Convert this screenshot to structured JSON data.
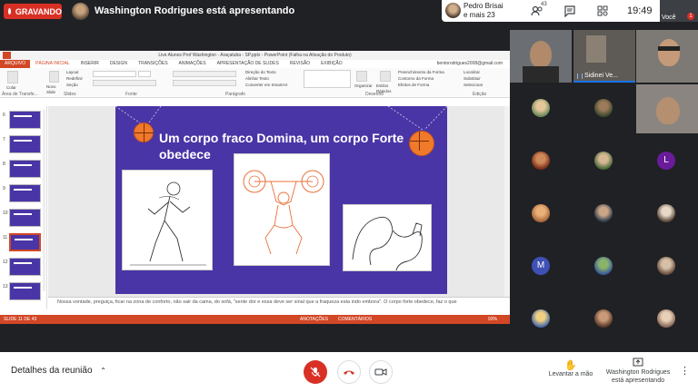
{
  "top": {
    "recording_label": "GRAVANDO",
    "presenting_text": "Washington Rodrigues está apresentando",
    "pedro_line1": "Pedro Brisai",
    "pedro_line2": "e mais 23",
    "participants_count": "43",
    "clock": "19:49",
    "self_label": "Você",
    "self_badge": "1"
  },
  "ppt": {
    "window_title": "Live Alunos Prof Washington - Araçatuba - SP.pptx - PowerPoint (Falha na Ativação do Produto)",
    "file_tab": "ARQUIVO",
    "tabs": [
      "PÁGINA INICIAL",
      "INSERIR",
      "DESIGN",
      "TRANSIÇÕES",
      "ANIMAÇÕES",
      "APRESENTAÇÃO DE SLIDES",
      "REVISÃO",
      "EXIBIÇÃO"
    ],
    "user_email": "bentorodrigues2008@gmail.com",
    "ribbon": {
      "paste": "Colar",
      "new_slide": "Novo Slide",
      "layout": "Layout",
      "reset": "Redefinir",
      "section": "Seção",
      "clipboard_group": "Área de Transfe...",
      "slides_group": "Slides",
      "font_group": "Fonte",
      "paragraph_group": "Parágrafo",
      "text_direction": "Direção do Texto",
      "align_text": "Alinhar Texto",
      "smartart": "Converter em SmartArt",
      "drawing_group": "Desenho",
      "arrange": "Organizar",
      "quick_styles": "Estilos Rápidos",
      "fill": "Preenchimento da Forma",
      "outline": "Contorno da Forma",
      "effects": "Efeitos de Forma",
      "find": "Localizar",
      "replace": "Substituir",
      "select": "Selecionar",
      "editing_group": "Edição"
    },
    "thumbnails": [
      {
        "num": "6"
      },
      {
        "num": "7"
      },
      {
        "num": "8"
      },
      {
        "num": "9"
      },
      {
        "num": "10"
      },
      {
        "num": "11"
      },
      {
        "num": "12"
      },
      {
        "num": "13"
      }
    ],
    "slide_title": "Um corpo fraco Domina, um corpo Forte obedece",
    "notes": "Nossa vontade, preguiça, ficar na zona de conforto, não sair da cama, do sofá, \"sente dor e essa deve ser sinal que a fraqueza esta indo embora\". O corpo forte obedece, faz o que",
    "status_slide": "SLIDE 11 DE 43",
    "status_notes": "ANOTAÇÕES",
    "status_comments": "COMENTÁRIOS",
    "zoom": "93%"
  },
  "grid": {
    "label_sidinei": "Sidinei Ve..."
  },
  "avatar_letters": {
    "l": "L",
    "m": "M"
  },
  "bottom": {
    "details": "Detalhes da reunião",
    "raise_hand": "Levantar a mão",
    "presenter_line1": "Washington Rodrigues",
    "presenter_line2": "está apresentando"
  },
  "colors": {
    "slide_bg": "#4a35a6",
    "accent_ppt": "#d24726",
    "record_red": "#d93025",
    "meet_dark": "#202124"
  }
}
